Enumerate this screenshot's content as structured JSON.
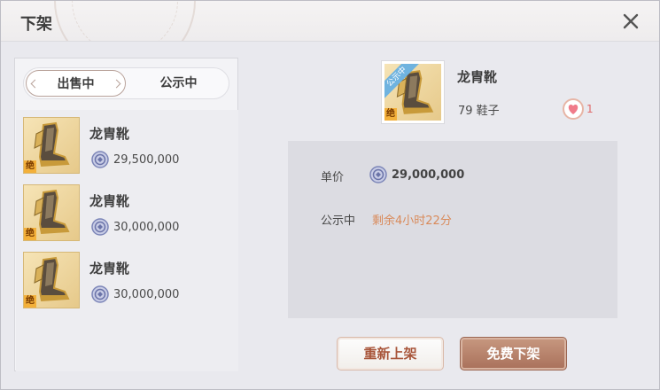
{
  "dialog": {
    "title": "下架"
  },
  "tabs": {
    "on_sale": "出售中",
    "public": "公示中"
  },
  "list": [
    {
      "name": "龙胄靴",
      "price": "29,500,000",
      "badge": "绝"
    },
    {
      "name": "龙胄靴",
      "price": "30,000,000",
      "badge": "绝"
    },
    {
      "name": "龙胄靴",
      "price": "30,000,000",
      "badge": "绝"
    }
  ],
  "detail": {
    "name": "龙胄靴",
    "type": "79 鞋子",
    "ribbon": "公示中",
    "badge": "绝",
    "likes": "1",
    "unit_price_label": "单价",
    "unit_price": "29,000,000",
    "status_label": "公示中",
    "remaining": "剩余4小时22分"
  },
  "buttons": {
    "relist": "重新上架",
    "free_delist": "免费下架"
  },
  "colors": {
    "accent": "#a9705a",
    "remaining_text": "#d98a5a",
    "ribbon": "#6fb3df"
  }
}
